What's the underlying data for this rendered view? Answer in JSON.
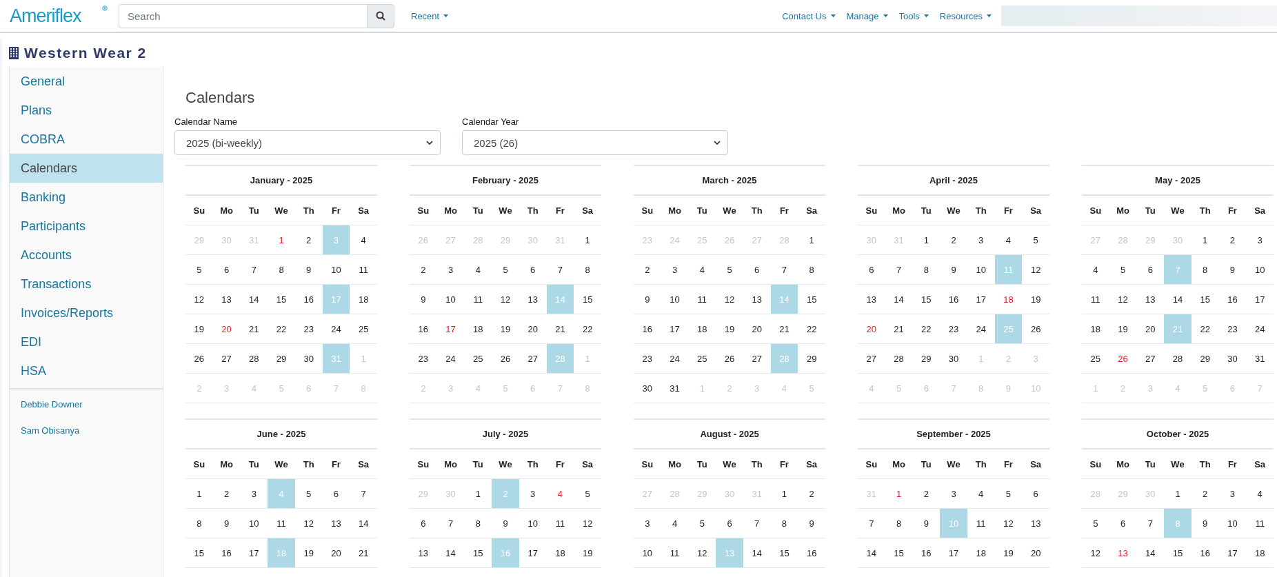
{
  "header": {
    "logo": "Ameriflex",
    "search": {
      "placeholder": "Search"
    },
    "recent": "Recent",
    "nav": [
      "Contact Us",
      "Manage",
      "Tools",
      "Resources"
    ]
  },
  "company": {
    "title": "Western Wear 2"
  },
  "sidebar": {
    "items": [
      {
        "label": "General",
        "selected": false
      },
      {
        "label": "Plans",
        "selected": false
      },
      {
        "label": "COBRA",
        "selected": false
      },
      {
        "label": "Calendars",
        "selected": true
      },
      {
        "label": "Banking",
        "selected": false
      },
      {
        "label": "Participants",
        "selected": false
      },
      {
        "label": "Accounts",
        "selected": false
      },
      {
        "label": "Transactions",
        "selected": false
      },
      {
        "label": "Invoices/Reports",
        "selected": false
      },
      {
        "label": "EDI",
        "selected": false
      },
      {
        "label": "HSA",
        "selected": false
      }
    ],
    "users": [
      "Debbie Downer",
      "Sam Obisanya"
    ]
  },
  "page": {
    "title": "Calendars",
    "calendar_name": {
      "label": "Calendar Name",
      "value": "2025 (bi-weekly)"
    },
    "calendar_year": {
      "label": "Calendar Year",
      "value": "2025 (26)"
    }
  },
  "months": [
    {
      "title": "January - 2025",
      "weekdays": [
        "Su",
        "Mo",
        "Tu",
        "We",
        "Th",
        "Fr",
        "Sa"
      ],
      "weeks": [
        [
          {
            "day": "29",
            "kind": "muted"
          },
          {
            "day": "30",
            "kind": "muted"
          },
          {
            "day": "31",
            "kind": "muted"
          },
          {
            "day": "1",
            "kind": "holiday"
          },
          {
            "day": "2",
            "kind": "normal"
          },
          {
            "day": "3",
            "kind": "payday"
          },
          {
            "day": "4",
            "kind": "normal"
          }
        ],
        [
          {
            "day": "5",
            "kind": "normal"
          },
          {
            "day": "6",
            "kind": "normal"
          },
          {
            "day": "7",
            "kind": "normal"
          },
          {
            "day": "8",
            "kind": "normal"
          },
          {
            "day": "9",
            "kind": "normal"
          },
          {
            "day": "10",
            "kind": "normal"
          },
          {
            "day": "11",
            "kind": "normal"
          }
        ],
        [
          {
            "day": "12",
            "kind": "normal"
          },
          {
            "day": "13",
            "kind": "normal"
          },
          {
            "day": "14",
            "kind": "normal"
          },
          {
            "day": "15",
            "kind": "normal"
          },
          {
            "day": "16",
            "kind": "normal"
          },
          {
            "day": "17",
            "kind": "payday"
          },
          {
            "day": "18",
            "kind": "normal"
          }
        ],
        [
          {
            "day": "19",
            "kind": "normal"
          },
          {
            "day": "20",
            "kind": "holiday"
          },
          {
            "day": "21",
            "kind": "normal"
          },
          {
            "day": "22",
            "kind": "normal"
          },
          {
            "day": "23",
            "kind": "normal"
          },
          {
            "day": "24",
            "kind": "normal"
          },
          {
            "day": "25",
            "kind": "normal"
          }
        ],
        [
          {
            "day": "26",
            "kind": "normal"
          },
          {
            "day": "27",
            "kind": "normal"
          },
          {
            "day": "28",
            "kind": "normal"
          },
          {
            "day": "29",
            "kind": "normal"
          },
          {
            "day": "30",
            "kind": "normal"
          },
          {
            "day": "31",
            "kind": "payday"
          },
          {
            "day": "1",
            "kind": "muted"
          }
        ],
        [
          {
            "day": "2",
            "kind": "muted"
          },
          {
            "day": "3",
            "kind": "muted"
          },
          {
            "day": "4",
            "kind": "muted"
          },
          {
            "day": "5",
            "kind": "muted"
          },
          {
            "day": "6",
            "kind": "muted"
          },
          {
            "day": "7",
            "kind": "muted"
          },
          {
            "day": "8",
            "kind": "muted"
          }
        ]
      ]
    },
    {
      "title": "February - 2025",
      "weekdays": [
        "Su",
        "Mo",
        "Tu",
        "We",
        "Th",
        "Fr",
        "Sa"
      ],
      "weeks": [
        [
          {
            "day": "26",
            "kind": "muted"
          },
          {
            "day": "27",
            "kind": "muted"
          },
          {
            "day": "28",
            "kind": "muted"
          },
          {
            "day": "29",
            "kind": "muted"
          },
          {
            "day": "30",
            "kind": "muted"
          },
          {
            "day": "31",
            "kind": "muted"
          },
          {
            "day": "1",
            "kind": "normal"
          }
        ],
        [
          {
            "day": "2",
            "kind": "normal"
          },
          {
            "day": "3",
            "kind": "normal"
          },
          {
            "day": "4",
            "kind": "normal"
          },
          {
            "day": "5",
            "kind": "normal"
          },
          {
            "day": "6",
            "kind": "normal"
          },
          {
            "day": "7",
            "kind": "normal"
          },
          {
            "day": "8",
            "kind": "normal"
          }
        ],
        [
          {
            "day": "9",
            "kind": "normal"
          },
          {
            "day": "10",
            "kind": "normal"
          },
          {
            "day": "11",
            "kind": "normal"
          },
          {
            "day": "12",
            "kind": "normal"
          },
          {
            "day": "13",
            "kind": "normal"
          },
          {
            "day": "14",
            "kind": "payday"
          },
          {
            "day": "15",
            "kind": "normal"
          }
        ],
        [
          {
            "day": "16",
            "kind": "normal"
          },
          {
            "day": "17",
            "kind": "holiday"
          },
          {
            "day": "18",
            "kind": "normal"
          },
          {
            "day": "19",
            "kind": "normal"
          },
          {
            "day": "20",
            "kind": "normal"
          },
          {
            "day": "21",
            "kind": "normal"
          },
          {
            "day": "22",
            "kind": "normal"
          }
        ],
        [
          {
            "day": "23",
            "kind": "normal"
          },
          {
            "day": "24",
            "kind": "normal"
          },
          {
            "day": "25",
            "kind": "normal"
          },
          {
            "day": "26",
            "kind": "normal"
          },
          {
            "day": "27",
            "kind": "normal"
          },
          {
            "day": "28",
            "kind": "payday"
          },
          {
            "day": "1",
            "kind": "muted"
          }
        ],
        [
          {
            "day": "2",
            "kind": "muted"
          },
          {
            "day": "3",
            "kind": "muted"
          },
          {
            "day": "4",
            "kind": "muted"
          },
          {
            "day": "5",
            "kind": "muted"
          },
          {
            "day": "6",
            "kind": "muted"
          },
          {
            "day": "7",
            "kind": "muted"
          },
          {
            "day": "8",
            "kind": "muted"
          }
        ]
      ]
    },
    {
      "title": "March - 2025",
      "weekdays": [
        "Su",
        "Mo",
        "Tu",
        "We",
        "Th",
        "Fr",
        "Sa"
      ],
      "weeks": [
        [
          {
            "day": "23",
            "kind": "muted"
          },
          {
            "day": "24",
            "kind": "muted"
          },
          {
            "day": "25",
            "kind": "muted"
          },
          {
            "day": "26",
            "kind": "muted"
          },
          {
            "day": "27",
            "kind": "muted"
          },
          {
            "day": "28",
            "kind": "muted"
          },
          {
            "day": "1",
            "kind": "normal"
          }
        ],
        [
          {
            "day": "2",
            "kind": "normal"
          },
          {
            "day": "3",
            "kind": "normal"
          },
          {
            "day": "4",
            "kind": "normal"
          },
          {
            "day": "5",
            "kind": "normal"
          },
          {
            "day": "6",
            "kind": "normal"
          },
          {
            "day": "7",
            "kind": "normal"
          },
          {
            "day": "8",
            "kind": "normal"
          }
        ],
        [
          {
            "day": "9",
            "kind": "normal"
          },
          {
            "day": "10",
            "kind": "normal"
          },
          {
            "day": "11",
            "kind": "normal"
          },
          {
            "day": "12",
            "kind": "normal"
          },
          {
            "day": "13",
            "kind": "normal"
          },
          {
            "day": "14",
            "kind": "payday"
          },
          {
            "day": "15",
            "kind": "normal"
          }
        ],
        [
          {
            "day": "16",
            "kind": "normal"
          },
          {
            "day": "17",
            "kind": "normal"
          },
          {
            "day": "18",
            "kind": "normal"
          },
          {
            "day": "19",
            "kind": "normal"
          },
          {
            "day": "20",
            "kind": "normal"
          },
          {
            "day": "21",
            "kind": "normal"
          },
          {
            "day": "22",
            "kind": "normal"
          }
        ],
        [
          {
            "day": "23",
            "kind": "normal"
          },
          {
            "day": "24",
            "kind": "normal"
          },
          {
            "day": "25",
            "kind": "normal"
          },
          {
            "day": "26",
            "kind": "normal"
          },
          {
            "day": "27",
            "kind": "normal"
          },
          {
            "day": "28",
            "kind": "payday"
          },
          {
            "day": "29",
            "kind": "normal"
          }
        ],
        [
          {
            "day": "30",
            "kind": "normal"
          },
          {
            "day": "31",
            "kind": "normal"
          },
          {
            "day": "1",
            "kind": "muted"
          },
          {
            "day": "2",
            "kind": "muted"
          },
          {
            "day": "3",
            "kind": "muted"
          },
          {
            "day": "4",
            "kind": "muted"
          },
          {
            "day": "5",
            "kind": "muted"
          }
        ]
      ]
    },
    {
      "title": "April - 2025",
      "weekdays": [
        "Su",
        "Mo",
        "Tu",
        "We",
        "Th",
        "Fr",
        "Sa"
      ],
      "weeks": [
        [
          {
            "day": "30",
            "kind": "muted"
          },
          {
            "day": "31",
            "kind": "muted"
          },
          {
            "day": "1",
            "kind": "normal"
          },
          {
            "day": "2",
            "kind": "normal"
          },
          {
            "day": "3",
            "kind": "normal"
          },
          {
            "day": "4",
            "kind": "normal"
          },
          {
            "day": "5",
            "kind": "normal"
          }
        ],
        [
          {
            "day": "6",
            "kind": "normal"
          },
          {
            "day": "7",
            "kind": "normal"
          },
          {
            "day": "8",
            "kind": "normal"
          },
          {
            "day": "9",
            "kind": "normal"
          },
          {
            "day": "10",
            "kind": "normal"
          },
          {
            "day": "11",
            "kind": "payday"
          },
          {
            "day": "12",
            "kind": "normal"
          }
        ],
        [
          {
            "day": "13",
            "kind": "normal"
          },
          {
            "day": "14",
            "kind": "normal"
          },
          {
            "day": "15",
            "kind": "normal"
          },
          {
            "day": "16",
            "kind": "normal"
          },
          {
            "day": "17",
            "kind": "normal"
          },
          {
            "day": "18",
            "kind": "holiday"
          },
          {
            "day": "19",
            "kind": "normal"
          }
        ],
        [
          {
            "day": "20",
            "kind": "holiday"
          },
          {
            "day": "21",
            "kind": "normal"
          },
          {
            "day": "22",
            "kind": "normal"
          },
          {
            "day": "23",
            "kind": "normal"
          },
          {
            "day": "24",
            "kind": "normal"
          },
          {
            "day": "25",
            "kind": "payday"
          },
          {
            "day": "26",
            "kind": "normal"
          }
        ],
        [
          {
            "day": "27",
            "kind": "normal"
          },
          {
            "day": "28",
            "kind": "normal"
          },
          {
            "day": "29",
            "kind": "normal"
          },
          {
            "day": "30",
            "kind": "normal"
          },
          {
            "day": "1",
            "kind": "muted"
          },
          {
            "day": "2",
            "kind": "muted"
          },
          {
            "day": "3",
            "kind": "muted"
          }
        ],
        [
          {
            "day": "4",
            "kind": "muted"
          },
          {
            "day": "5",
            "kind": "muted"
          },
          {
            "day": "6",
            "kind": "muted"
          },
          {
            "day": "7",
            "kind": "muted"
          },
          {
            "day": "8",
            "kind": "muted"
          },
          {
            "day": "9",
            "kind": "muted"
          },
          {
            "day": "10",
            "kind": "muted"
          }
        ]
      ]
    },
    {
      "title": "May - 2025",
      "weekdays": [
        "Su",
        "Mo",
        "Tu",
        "We",
        "Th",
        "Fr",
        "Sa"
      ],
      "weeks": [
        [
          {
            "day": "27",
            "kind": "muted"
          },
          {
            "day": "28",
            "kind": "muted"
          },
          {
            "day": "29",
            "kind": "muted"
          },
          {
            "day": "30",
            "kind": "muted"
          },
          {
            "day": "1",
            "kind": "normal"
          },
          {
            "day": "2",
            "kind": "normal"
          },
          {
            "day": "3",
            "kind": "normal"
          }
        ],
        [
          {
            "day": "4",
            "kind": "normal"
          },
          {
            "day": "5",
            "kind": "normal"
          },
          {
            "day": "6",
            "kind": "normal"
          },
          {
            "day": "7",
            "kind": "payday"
          },
          {
            "day": "8",
            "kind": "normal"
          },
          {
            "day": "9",
            "kind": "normal"
          },
          {
            "day": "10",
            "kind": "normal"
          }
        ],
        [
          {
            "day": "11",
            "kind": "normal"
          },
          {
            "day": "12",
            "kind": "normal"
          },
          {
            "day": "13",
            "kind": "normal"
          },
          {
            "day": "14",
            "kind": "normal"
          },
          {
            "day": "15",
            "kind": "normal"
          },
          {
            "day": "16",
            "kind": "normal"
          },
          {
            "day": "17",
            "kind": "normal"
          }
        ],
        [
          {
            "day": "18",
            "kind": "normal"
          },
          {
            "day": "19",
            "kind": "normal"
          },
          {
            "day": "20",
            "kind": "normal"
          },
          {
            "day": "21",
            "kind": "payday"
          },
          {
            "day": "22",
            "kind": "normal"
          },
          {
            "day": "23",
            "kind": "normal"
          },
          {
            "day": "24",
            "kind": "normal"
          }
        ],
        [
          {
            "day": "25",
            "kind": "normal"
          },
          {
            "day": "26",
            "kind": "holiday"
          },
          {
            "day": "27",
            "kind": "normal"
          },
          {
            "day": "28",
            "kind": "normal"
          },
          {
            "day": "29",
            "kind": "normal"
          },
          {
            "day": "30",
            "kind": "normal"
          },
          {
            "day": "31",
            "kind": "normal"
          }
        ],
        [
          {
            "day": "1",
            "kind": "muted"
          },
          {
            "day": "2",
            "kind": "muted"
          },
          {
            "day": "3",
            "kind": "muted"
          },
          {
            "day": "4",
            "kind": "muted"
          },
          {
            "day": "5",
            "kind": "muted"
          },
          {
            "day": "6",
            "kind": "muted"
          },
          {
            "day": "7",
            "kind": "muted"
          }
        ]
      ]
    },
    {
      "title": "June - 2025",
      "weekdays": [
        "Su",
        "Mo",
        "Tu",
        "We",
        "Th",
        "Fr",
        "Sa"
      ],
      "weeks": [
        [
          {
            "day": "1",
            "kind": "normal"
          },
          {
            "day": "2",
            "kind": "normal"
          },
          {
            "day": "3",
            "kind": "normal"
          },
          {
            "day": "4",
            "kind": "payday"
          },
          {
            "day": "5",
            "kind": "normal"
          },
          {
            "day": "6",
            "kind": "normal"
          },
          {
            "day": "7",
            "kind": "normal"
          }
        ],
        [
          {
            "day": "8",
            "kind": "normal"
          },
          {
            "day": "9",
            "kind": "normal"
          },
          {
            "day": "10",
            "kind": "normal"
          },
          {
            "day": "11",
            "kind": "normal"
          },
          {
            "day": "12",
            "kind": "normal"
          },
          {
            "day": "13",
            "kind": "normal"
          },
          {
            "day": "14",
            "kind": "normal"
          }
        ],
        [
          {
            "day": "15",
            "kind": "normal"
          },
          {
            "day": "16",
            "kind": "normal"
          },
          {
            "day": "17",
            "kind": "normal"
          },
          {
            "day": "18",
            "kind": "payday"
          },
          {
            "day": "19",
            "kind": "normal"
          },
          {
            "day": "20",
            "kind": "normal"
          },
          {
            "day": "21",
            "kind": "normal"
          }
        ]
      ]
    },
    {
      "title": "July - 2025",
      "weekdays": [
        "Su",
        "Mo",
        "Tu",
        "We",
        "Th",
        "Fr",
        "Sa"
      ],
      "weeks": [
        [
          {
            "day": "29",
            "kind": "muted"
          },
          {
            "day": "30",
            "kind": "muted"
          },
          {
            "day": "1",
            "kind": "normal"
          },
          {
            "day": "2",
            "kind": "payday"
          },
          {
            "day": "3",
            "kind": "normal"
          },
          {
            "day": "4",
            "kind": "holiday"
          },
          {
            "day": "5",
            "kind": "normal"
          }
        ],
        [
          {
            "day": "6",
            "kind": "normal"
          },
          {
            "day": "7",
            "kind": "normal"
          },
          {
            "day": "8",
            "kind": "normal"
          },
          {
            "day": "9",
            "kind": "normal"
          },
          {
            "day": "10",
            "kind": "normal"
          },
          {
            "day": "11",
            "kind": "normal"
          },
          {
            "day": "12",
            "kind": "normal"
          }
        ],
        [
          {
            "day": "13",
            "kind": "normal"
          },
          {
            "day": "14",
            "kind": "normal"
          },
          {
            "day": "15",
            "kind": "normal"
          },
          {
            "day": "16",
            "kind": "payday"
          },
          {
            "day": "17",
            "kind": "normal"
          },
          {
            "day": "18",
            "kind": "normal"
          },
          {
            "day": "19",
            "kind": "normal"
          }
        ]
      ]
    },
    {
      "title": "August - 2025",
      "weekdays": [
        "Su",
        "Mo",
        "Tu",
        "We",
        "Th",
        "Fr",
        "Sa"
      ],
      "weeks": [
        [
          {
            "day": "27",
            "kind": "muted"
          },
          {
            "day": "28",
            "kind": "muted"
          },
          {
            "day": "29",
            "kind": "muted"
          },
          {
            "day": "30",
            "kind": "muted"
          },
          {
            "day": "31",
            "kind": "muted"
          },
          {
            "day": "1",
            "kind": "normal"
          },
          {
            "day": "2",
            "kind": "normal"
          }
        ],
        [
          {
            "day": "3",
            "kind": "normal"
          },
          {
            "day": "4",
            "kind": "normal"
          },
          {
            "day": "5",
            "kind": "normal"
          },
          {
            "day": "6",
            "kind": "normal"
          },
          {
            "day": "7",
            "kind": "normal"
          },
          {
            "day": "8",
            "kind": "normal"
          },
          {
            "day": "9",
            "kind": "normal"
          }
        ],
        [
          {
            "day": "10",
            "kind": "normal"
          },
          {
            "day": "11",
            "kind": "normal"
          },
          {
            "day": "12",
            "kind": "normal"
          },
          {
            "day": "13",
            "kind": "payday"
          },
          {
            "day": "14",
            "kind": "normal"
          },
          {
            "day": "15",
            "kind": "normal"
          },
          {
            "day": "16",
            "kind": "normal"
          }
        ]
      ]
    },
    {
      "title": "September - 2025",
      "weekdays": [
        "Su",
        "Mo",
        "Tu",
        "We",
        "Th",
        "Fr",
        "Sa"
      ],
      "weeks": [
        [
          {
            "day": "31",
            "kind": "muted"
          },
          {
            "day": "1",
            "kind": "holiday"
          },
          {
            "day": "2",
            "kind": "normal"
          },
          {
            "day": "3",
            "kind": "normal"
          },
          {
            "day": "4",
            "kind": "normal"
          },
          {
            "day": "5",
            "kind": "normal"
          },
          {
            "day": "6",
            "kind": "normal"
          }
        ],
        [
          {
            "day": "7",
            "kind": "normal"
          },
          {
            "day": "8",
            "kind": "normal"
          },
          {
            "day": "9",
            "kind": "normal"
          },
          {
            "day": "10",
            "kind": "payday"
          },
          {
            "day": "11",
            "kind": "normal"
          },
          {
            "day": "12",
            "kind": "normal"
          },
          {
            "day": "13",
            "kind": "normal"
          }
        ],
        [
          {
            "day": "14",
            "kind": "normal"
          },
          {
            "day": "15",
            "kind": "normal"
          },
          {
            "day": "16",
            "kind": "normal"
          },
          {
            "day": "17",
            "kind": "normal"
          },
          {
            "day": "18",
            "kind": "normal"
          },
          {
            "day": "19",
            "kind": "normal"
          },
          {
            "day": "20",
            "kind": "normal"
          }
        ]
      ]
    },
    {
      "title": "October - 2025",
      "weekdays": [
        "Su",
        "Mo",
        "Tu",
        "We",
        "Th",
        "Fr",
        "Sa"
      ],
      "weeks": [
        [
          {
            "day": "28",
            "kind": "muted"
          },
          {
            "day": "29",
            "kind": "muted"
          },
          {
            "day": "30",
            "kind": "muted"
          },
          {
            "day": "1",
            "kind": "normal"
          },
          {
            "day": "2",
            "kind": "normal"
          },
          {
            "day": "3",
            "kind": "normal"
          },
          {
            "day": "4",
            "kind": "normal"
          }
        ],
        [
          {
            "day": "5",
            "kind": "normal"
          },
          {
            "day": "6",
            "kind": "normal"
          },
          {
            "day": "7",
            "kind": "normal"
          },
          {
            "day": "8",
            "kind": "payday"
          },
          {
            "day": "9",
            "kind": "normal"
          },
          {
            "day": "10",
            "kind": "normal"
          },
          {
            "day": "11",
            "kind": "normal"
          }
        ],
        [
          {
            "day": "12",
            "kind": "normal"
          },
          {
            "day": "13",
            "kind": "holiday"
          },
          {
            "day": "14",
            "kind": "normal"
          },
          {
            "day": "15",
            "kind": "normal"
          },
          {
            "day": "16",
            "kind": "normal"
          },
          {
            "day": "17",
            "kind": "normal"
          },
          {
            "day": "18",
            "kind": "normal"
          }
        ]
      ]
    }
  ]
}
